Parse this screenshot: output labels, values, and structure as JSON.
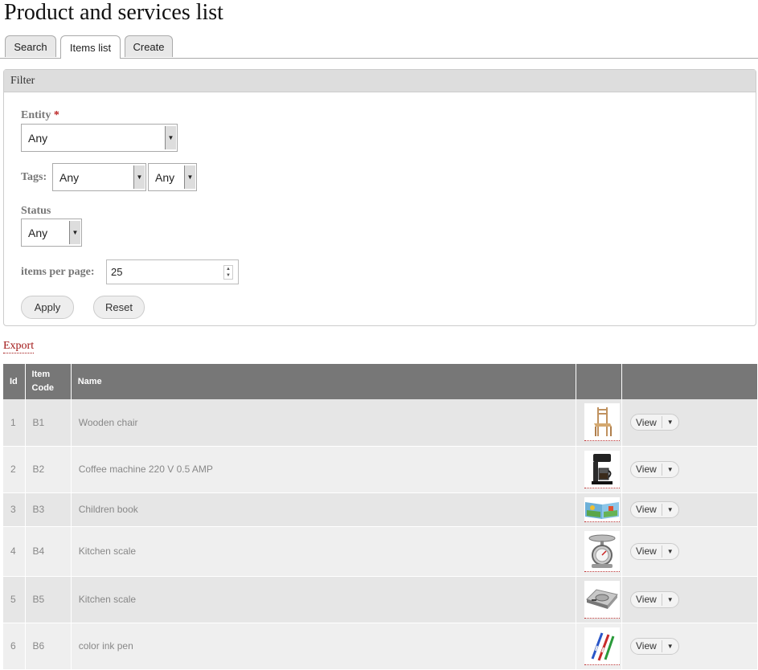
{
  "page": {
    "title": "Product and services list"
  },
  "tabs": [
    {
      "label": "Search",
      "active": false
    },
    {
      "label": "Items list",
      "active": true
    },
    {
      "label": "Create",
      "active": false
    }
  ],
  "filter": {
    "title": "Filter",
    "entity_label": "Entity",
    "required_mark": "*",
    "entity_value": "Any",
    "tags_label": "Tags:",
    "tags_value_1": "Any",
    "tags_value_2": "Any",
    "status_label": "Status",
    "status_value": "Any",
    "per_page_label": "items per page:",
    "per_page_value": "25",
    "apply_label": "Apply",
    "reset_label": "Reset"
  },
  "export_label": "Export",
  "table": {
    "headers": {
      "id": "Id",
      "code_1": "Item",
      "code_2": "Code",
      "name": "Name"
    },
    "view_label": "View",
    "rows": [
      {
        "id": "1",
        "code": "B1",
        "name": "Wooden chair",
        "icon": "chair-thumbnail"
      },
      {
        "id": "2",
        "code": "B2",
        "name": "Coffee machine 220 V 0.5 AMP",
        "icon": "coffee-machine-thumbnail"
      },
      {
        "id": "3",
        "code": "B3",
        "name": "Children book",
        "icon": "book-thumbnail"
      },
      {
        "id": "4",
        "code": "B4",
        "name": "Kitchen scale",
        "icon": "scale-thumbnail"
      },
      {
        "id": "5",
        "code": "B5",
        "name": "Kitchen scale",
        "icon": "digital-scale-thumbnail"
      },
      {
        "id": "6",
        "code": "B6",
        "name": "color ink pen",
        "icon": "pens-thumbnail"
      }
    ]
  }
}
